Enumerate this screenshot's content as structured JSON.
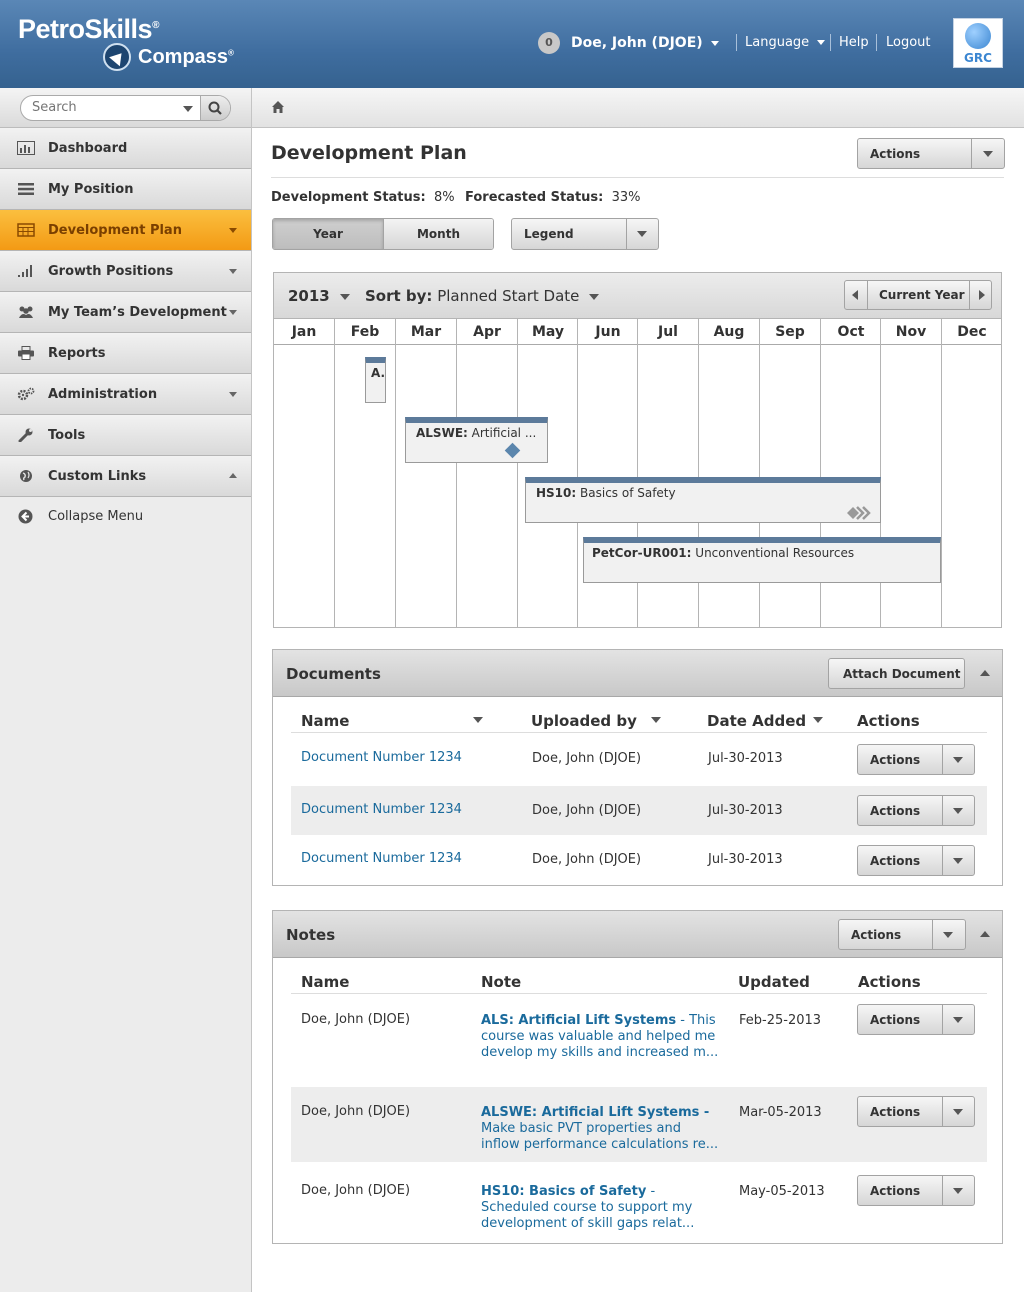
{
  "header": {
    "brand_top": "PetroSkills",
    "brand_bottom": "Compass",
    "notification_count": "0",
    "user_name": "Doe, John (DJOE)",
    "language_label": "Language",
    "help_label": "Help",
    "logout_label": "Logout",
    "grc_label": "GRC"
  },
  "sidebar": {
    "search_placeholder": "Search",
    "items": [
      {
        "label": "Dashboard",
        "icon": "bar-chart-icon"
      },
      {
        "label": "My Position",
        "icon": "list-icon"
      },
      {
        "label": "Development Plan",
        "icon": "calendar-icon",
        "active": true
      },
      {
        "label": "Growth Positions",
        "icon": "signal-icon"
      },
      {
        "label": "My Team’s Development",
        "icon": "team-icon"
      },
      {
        "label": "Reports",
        "icon": "printer-icon"
      },
      {
        "label": "Administration",
        "icon": "gears-icon"
      },
      {
        "label": "Tools",
        "icon": "wrench-icon"
      },
      {
        "label": "Custom Links",
        "icon": "globe-icon"
      }
    ],
    "collapse_label": "Collapse Menu"
  },
  "page": {
    "title": "Development Plan",
    "actions_label": "Actions",
    "development_status_label": "Development Status:",
    "development_status_value": "8%",
    "forecasted_status_label": "Forecasted Status:",
    "forecasted_status_value": "33%",
    "view_year": "Year",
    "view_month": "Month",
    "legend_label": "Legend"
  },
  "gantt": {
    "year": "2013",
    "sort_label": "Sort by:",
    "sort_value": "Planned Start Date",
    "current_year_label": "Current Year",
    "months": [
      "Jan",
      "Feb",
      "Mar",
      "Apr",
      "May",
      "Jun",
      "Jul",
      "Aug",
      "Sep",
      "Oct",
      "Nov",
      "Dec"
    ],
    "bars": [
      {
        "code": "A.",
        "name": ""
      },
      {
        "code": "ALSWE:",
        "name": "Artificial ..."
      },
      {
        "code": "HS10:",
        "name": "Basics of Safety"
      },
      {
        "code": "PetCor-UR001:",
        "name": "Unconventional Resources"
      }
    ]
  },
  "documents": {
    "title": "Documents",
    "attach_label": "Attach Document",
    "columns": {
      "name": "Name",
      "uploaded_by": "Uploaded by",
      "date_added": "Date Added",
      "actions": "Actions"
    },
    "rows": [
      {
        "name": "Document Number 1234",
        "uploaded_by": "Doe, John (DJOE)",
        "date": "Jul-30-2013",
        "action": "Actions"
      },
      {
        "name": "Document Number 1234",
        "uploaded_by": "Doe, John (DJOE)",
        "date": "Jul-30-2013",
        "action": "Actions"
      },
      {
        "name": "Document Number 1234",
        "uploaded_by": "Doe, John (DJOE)",
        "date": "Jul-30-2013",
        "action": "Actions"
      }
    ]
  },
  "notes": {
    "title": "Notes",
    "actions_label": "Actions",
    "columns": {
      "name": "Name",
      "note": "Note",
      "updated": "Updated",
      "actions": "Actions"
    },
    "rows": [
      {
        "name": "Doe, John (DJOE)",
        "title": "ALS: Artificial Lift Systems",
        "text_l1": " - This",
        "text_l2": "course was valuable and helped me",
        "text_l3": "develop my skills and increased m...",
        "updated": "Feb-25-2013",
        "action": "Actions"
      },
      {
        "name": "Doe, John (DJOE)",
        "title": "ALSWE: Artificial Lift Systems -",
        "text_l1": "",
        "text_l2": "Make basic PVT properties and",
        "text_l3": "inflow performance calculations re...",
        "updated": "Mar-05-2013",
        "action": "Actions"
      },
      {
        "name": "Doe, John (DJOE)",
        "title": "HS10: Basics of Safety",
        "text_l1": " -",
        "text_l2": "Scheduled course to support my",
        "text_l3": "development of skill gaps relat...",
        "updated": "May-05-2013",
        "action": "Actions"
      }
    ]
  }
}
